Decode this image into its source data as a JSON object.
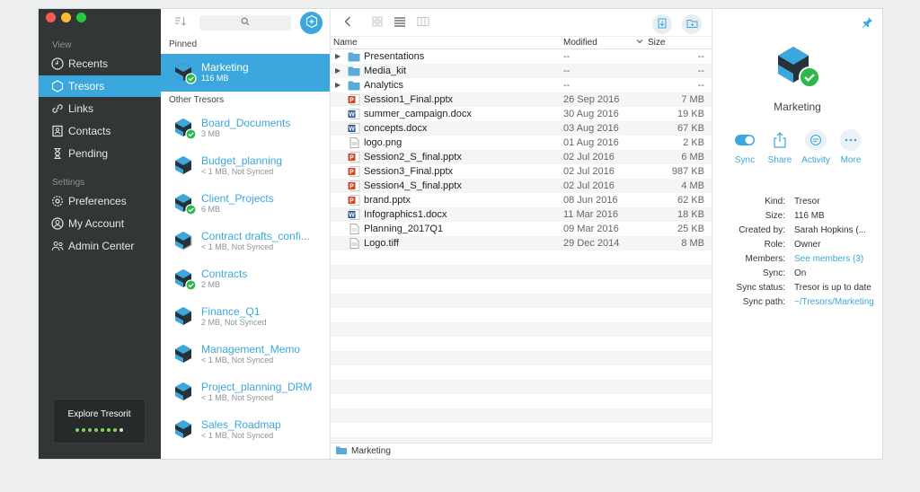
{
  "sidebar": {
    "view_heading": "View",
    "view_items": [
      {
        "label": "Recents",
        "icon": "clock-icon"
      },
      {
        "label": "Tresors",
        "icon": "tresor-icon",
        "active": true
      },
      {
        "label": "Links",
        "icon": "link-icon"
      },
      {
        "label": "Contacts",
        "icon": "contacts-icon"
      },
      {
        "label": "Pending",
        "icon": "hourglass-icon"
      }
    ],
    "settings_heading": "Settings",
    "settings_items": [
      {
        "label": "Preferences",
        "icon": "gear-icon"
      },
      {
        "label": "My Account",
        "icon": "user-icon"
      },
      {
        "label": "Admin Center",
        "icon": "admin-icon"
      }
    ],
    "explore_label": "Explore Tresorit",
    "explore_progress": {
      "completed": 7,
      "total": 8
    }
  },
  "tresor_list": {
    "pinned_heading": "Pinned",
    "pinned": [
      {
        "name": "Marketing",
        "sub": "116 MB",
        "synced": true,
        "active": true
      }
    ],
    "other_heading": "Other Tresors",
    "others": [
      {
        "name": "Board_Documents",
        "sub": "3 MB",
        "synced": true
      },
      {
        "name": "Budget_planning",
        "sub": "< 1 MB, Not Synced",
        "synced": false
      },
      {
        "name": "Client_Projects",
        "sub": "6 MB",
        "synced": true
      },
      {
        "name": "Contract drafts_confi...",
        "sub": "< 1 MB, Not Synced",
        "synced": false,
        "shared": true
      },
      {
        "name": "Contracts",
        "sub": "2 MB",
        "synced": true
      },
      {
        "name": "Finance_Q1",
        "sub": "2 MB, Not Synced",
        "synced": false
      },
      {
        "name": "Management_Memo",
        "sub": "< 1 MB, Not Synced",
        "synced": false
      },
      {
        "name": "Project_planning_DRM",
        "sub": "< 1 MB, Not Synced",
        "synced": false
      },
      {
        "name": "Sales_Roadmap",
        "sub": "< 1 MB, Not Synced",
        "synced": false
      }
    ]
  },
  "files": {
    "columns": {
      "name": "Name",
      "modified": "Modified",
      "size": "Size"
    },
    "rows": [
      {
        "name": "Presentations",
        "modified": "--",
        "size": "--",
        "type": "folder"
      },
      {
        "name": "Media_kit",
        "modified": "--",
        "size": "--",
        "type": "folder"
      },
      {
        "name": "Analytics",
        "modified": "--",
        "size": "--",
        "type": "folder"
      },
      {
        "name": "Session1_Final.pptx",
        "modified": "26 Sep 2016",
        "size": "7 MB",
        "type": "pptx"
      },
      {
        "name": "summer_campaign.docx",
        "modified": "30 Aug 2016",
        "size": "19 KB",
        "type": "docx"
      },
      {
        "name": "concepts.docx",
        "modified": "03 Aug 2016",
        "size": "67 KB",
        "type": "docx"
      },
      {
        "name": "logo.png",
        "modified": "01 Aug 2016",
        "size": "2 KB",
        "type": "image"
      },
      {
        "name": "Session2_S_final.pptx",
        "modified": "02 Jul 2016",
        "size": "6 MB",
        "type": "pptx"
      },
      {
        "name": "Session3_Final.pptx",
        "modified": "02 Jul 2016",
        "size": "987 KB",
        "type": "pptx"
      },
      {
        "name": "Session4_S_final.pptx",
        "modified": "02 Jul 2016",
        "size": "4 MB",
        "type": "pptx"
      },
      {
        "name": "brand.pptx",
        "modified": "08 Jun 2016",
        "size": "62 KB",
        "type": "pptx"
      },
      {
        "name": "Infographics1.docx",
        "modified": "11 Mar 2016",
        "size": "18 KB",
        "type": "docx"
      },
      {
        "name": "Planning_2017Q1",
        "modified": "09 Mar 2016",
        "size": "25 KB",
        "type": "generic"
      },
      {
        "name": "Logo.tiff",
        "modified": "29 Dec 2014",
        "size": "8 MB",
        "type": "image"
      }
    ],
    "empty_rows": 14,
    "path": "Marketing"
  },
  "info": {
    "title": "Marketing",
    "actions": [
      {
        "label": "Sync",
        "icon": "toggle-icon"
      },
      {
        "label": "Share",
        "icon": "share-icon"
      },
      {
        "label": "Activity",
        "icon": "activity-icon"
      },
      {
        "label": "More",
        "icon": "more-icon"
      }
    ],
    "properties": [
      {
        "key": "Kind:",
        "value": "Tresor"
      },
      {
        "key": "Size:",
        "value": "116 MB"
      },
      {
        "key": "Created by:",
        "value": "Sarah Hopkins (..."
      },
      {
        "key": "Role:",
        "value": "Owner"
      },
      {
        "key": "Members:",
        "value": "See members (3)",
        "link": true
      },
      {
        "key": "Sync:",
        "value": "On"
      },
      {
        "key": "Sync status:",
        "value": "Tresor is up to date"
      },
      {
        "key": "Sync path:",
        "value": "~/Tresors/Marketing",
        "link": true
      }
    ]
  },
  "colors": {
    "accent": "#3ba7dd",
    "sidebar": "#323637",
    "synced": "#2db84d"
  }
}
